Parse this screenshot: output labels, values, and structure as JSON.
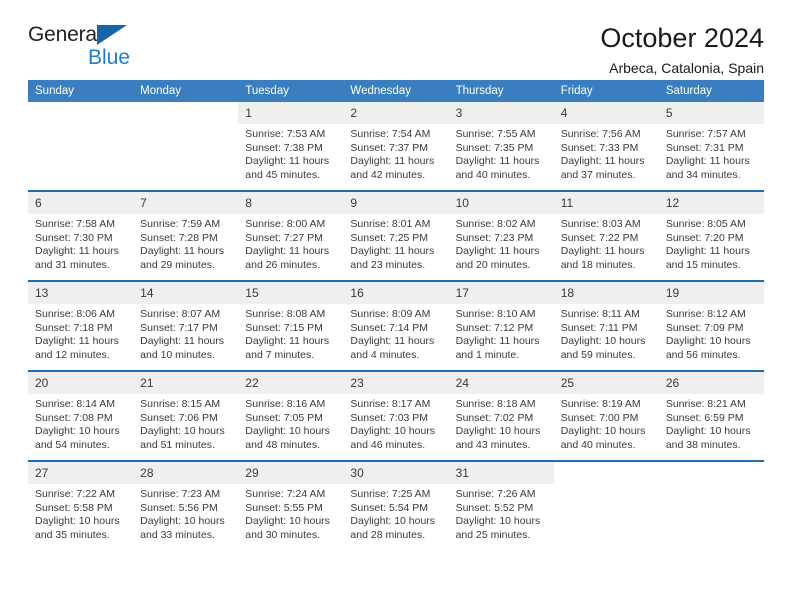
{
  "brand": {
    "name_top": "General",
    "name_bottom": "Blue",
    "triangle_color": "#1565a8",
    "blue_text_color": "#1f7fc4"
  },
  "header": {
    "title": "October 2024",
    "subtitle": "Arbeca, Catalonia, Spain"
  },
  "theme": {
    "header_bg": "#3a7ebf",
    "separator": "#1f6cb0",
    "daynum_bg": "#efefef",
    "text": "#3a3a3a"
  },
  "weekday_headers": [
    "Sunday",
    "Monday",
    "Tuesday",
    "Wednesday",
    "Thursday",
    "Friday",
    "Saturday"
  ],
  "labels": {
    "sunrise_prefix": "Sunrise:",
    "sunset_prefix": "Sunset:",
    "daylight_prefix": "Daylight:"
  },
  "weeks": [
    [
      {
        "day": "",
        "sunrise": "",
        "sunset": "",
        "daylight": "",
        "blank": true
      },
      {
        "day": "",
        "sunrise": "",
        "sunset": "",
        "daylight": "",
        "blank": true
      },
      {
        "day": "1",
        "sunrise": "Sunrise: 7:53 AM",
        "sunset": "Sunset: 7:38 PM",
        "daylight": "Daylight: 11 hours and 45 minutes."
      },
      {
        "day": "2",
        "sunrise": "Sunrise: 7:54 AM",
        "sunset": "Sunset: 7:37 PM",
        "daylight": "Daylight: 11 hours and 42 minutes."
      },
      {
        "day": "3",
        "sunrise": "Sunrise: 7:55 AM",
        "sunset": "Sunset: 7:35 PM",
        "daylight": "Daylight: 11 hours and 40 minutes."
      },
      {
        "day": "4",
        "sunrise": "Sunrise: 7:56 AM",
        "sunset": "Sunset: 7:33 PM",
        "daylight": "Daylight: 11 hours and 37 minutes."
      },
      {
        "day": "5",
        "sunrise": "Sunrise: 7:57 AM",
        "sunset": "Sunset: 7:31 PM",
        "daylight": "Daylight: 11 hours and 34 minutes."
      }
    ],
    [
      {
        "day": "6",
        "sunrise": "Sunrise: 7:58 AM",
        "sunset": "Sunset: 7:30 PM",
        "daylight": "Daylight: 11 hours and 31 minutes."
      },
      {
        "day": "7",
        "sunrise": "Sunrise: 7:59 AM",
        "sunset": "Sunset: 7:28 PM",
        "daylight": "Daylight: 11 hours and 29 minutes."
      },
      {
        "day": "8",
        "sunrise": "Sunrise: 8:00 AM",
        "sunset": "Sunset: 7:27 PM",
        "daylight": "Daylight: 11 hours and 26 minutes."
      },
      {
        "day": "9",
        "sunrise": "Sunrise: 8:01 AM",
        "sunset": "Sunset: 7:25 PM",
        "daylight": "Daylight: 11 hours and 23 minutes."
      },
      {
        "day": "10",
        "sunrise": "Sunrise: 8:02 AM",
        "sunset": "Sunset: 7:23 PM",
        "daylight": "Daylight: 11 hours and 20 minutes."
      },
      {
        "day": "11",
        "sunrise": "Sunrise: 8:03 AM",
        "sunset": "Sunset: 7:22 PM",
        "daylight": "Daylight: 11 hours and 18 minutes."
      },
      {
        "day": "12",
        "sunrise": "Sunrise: 8:05 AM",
        "sunset": "Sunset: 7:20 PM",
        "daylight": "Daylight: 11 hours and 15 minutes."
      }
    ],
    [
      {
        "day": "13",
        "sunrise": "Sunrise: 8:06 AM",
        "sunset": "Sunset: 7:18 PM",
        "daylight": "Daylight: 11 hours and 12 minutes."
      },
      {
        "day": "14",
        "sunrise": "Sunrise: 8:07 AM",
        "sunset": "Sunset: 7:17 PM",
        "daylight": "Daylight: 11 hours and 10 minutes."
      },
      {
        "day": "15",
        "sunrise": "Sunrise: 8:08 AM",
        "sunset": "Sunset: 7:15 PM",
        "daylight": "Daylight: 11 hours and 7 minutes."
      },
      {
        "day": "16",
        "sunrise": "Sunrise: 8:09 AM",
        "sunset": "Sunset: 7:14 PM",
        "daylight": "Daylight: 11 hours and 4 minutes."
      },
      {
        "day": "17",
        "sunrise": "Sunrise: 8:10 AM",
        "sunset": "Sunset: 7:12 PM",
        "daylight": "Daylight: 11 hours and 1 minute."
      },
      {
        "day": "18",
        "sunrise": "Sunrise: 8:11 AM",
        "sunset": "Sunset: 7:11 PM",
        "daylight": "Daylight: 10 hours and 59 minutes."
      },
      {
        "day": "19",
        "sunrise": "Sunrise: 8:12 AM",
        "sunset": "Sunset: 7:09 PM",
        "daylight": "Daylight: 10 hours and 56 minutes."
      }
    ],
    [
      {
        "day": "20",
        "sunrise": "Sunrise: 8:14 AM",
        "sunset": "Sunset: 7:08 PM",
        "daylight": "Daylight: 10 hours and 54 minutes."
      },
      {
        "day": "21",
        "sunrise": "Sunrise: 8:15 AM",
        "sunset": "Sunset: 7:06 PM",
        "daylight": "Daylight: 10 hours and 51 minutes."
      },
      {
        "day": "22",
        "sunrise": "Sunrise: 8:16 AM",
        "sunset": "Sunset: 7:05 PM",
        "daylight": "Daylight: 10 hours and 48 minutes."
      },
      {
        "day": "23",
        "sunrise": "Sunrise: 8:17 AM",
        "sunset": "Sunset: 7:03 PM",
        "daylight": "Daylight: 10 hours and 46 minutes."
      },
      {
        "day": "24",
        "sunrise": "Sunrise: 8:18 AM",
        "sunset": "Sunset: 7:02 PM",
        "daylight": "Daylight: 10 hours and 43 minutes."
      },
      {
        "day": "25",
        "sunrise": "Sunrise: 8:19 AM",
        "sunset": "Sunset: 7:00 PM",
        "daylight": "Daylight: 10 hours and 40 minutes."
      },
      {
        "day": "26",
        "sunrise": "Sunrise: 8:21 AM",
        "sunset": "Sunset: 6:59 PM",
        "daylight": "Daylight: 10 hours and 38 minutes."
      }
    ],
    [
      {
        "day": "27",
        "sunrise": "Sunrise: 7:22 AM",
        "sunset": "Sunset: 5:58 PM",
        "daylight": "Daylight: 10 hours and 35 minutes."
      },
      {
        "day": "28",
        "sunrise": "Sunrise: 7:23 AM",
        "sunset": "Sunset: 5:56 PM",
        "daylight": "Daylight: 10 hours and 33 minutes."
      },
      {
        "day": "29",
        "sunrise": "Sunrise: 7:24 AM",
        "sunset": "Sunset: 5:55 PM",
        "daylight": "Daylight: 10 hours and 30 minutes."
      },
      {
        "day": "30",
        "sunrise": "Sunrise: 7:25 AM",
        "sunset": "Sunset: 5:54 PM",
        "daylight": "Daylight: 10 hours and 28 minutes."
      },
      {
        "day": "31",
        "sunrise": "Sunrise: 7:26 AM",
        "sunset": "Sunset: 5:52 PM",
        "daylight": "Daylight: 10 hours and 25 minutes."
      },
      {
        "day": "",
        "sunrise": "",
        "sunset": "",
        "daylight": "",
        "blank": true
      },
      {
        "day": "",
        "sunrise": "",
        "sunset": "",
        "daylight": "",
        "blank": true
      }
    ]
  ]
}
